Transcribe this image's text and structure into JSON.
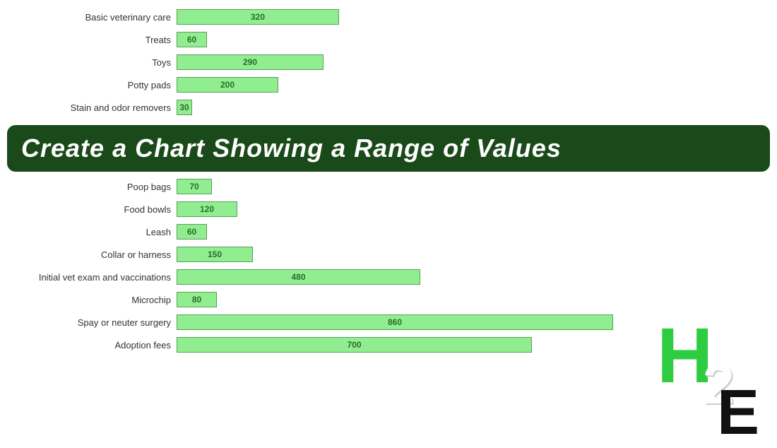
{
  "banner": {
    "text": "Create a Chart Showing a Range of Values"
  },
  "top_bars": [
    {
      "label": "Basic veterinary care",
      "value": 320,
      "px": 230
    },
    {
      "label": "Treats",
      "value": 60,
      "px": 43
    },
    {
      "label": "Toys",
      "value": 290,
      "px": 208
    },
    {
      "label": "Potty pads",
      "value": 200,
      "px": 144
    },
    {
      "label": "Stain and odor removers",
      "value": 30,
      "px": 22
    }
  ],
  "bottom_bars": [
    {
      "label": "Poop bags",
      "value": 70,
      "px": 50
    },
    {
      "label": "Food bowls",
      "value": 120,
      "px": 86
    },
    {
      "label": "Leash",
      "value": 60,
      "px": 43
    },
    {
      "label": "Collar or harness",
      "value": 150,
      "px": 108
    },
    {
      "label": "Initial vet exam and vaccinations",
      "value": 480,
      "px": 345
    },
    {
      "label": "Microchip",
      "value": 80,
      "px": 57
    },
    {
      "label": "Spay or neuter surgery",
      "value": 860,
      "px": 618
    },
    {
      "label": "Adoption fees",
      "value": 700,
      "px": 503
    }
  ]
}
